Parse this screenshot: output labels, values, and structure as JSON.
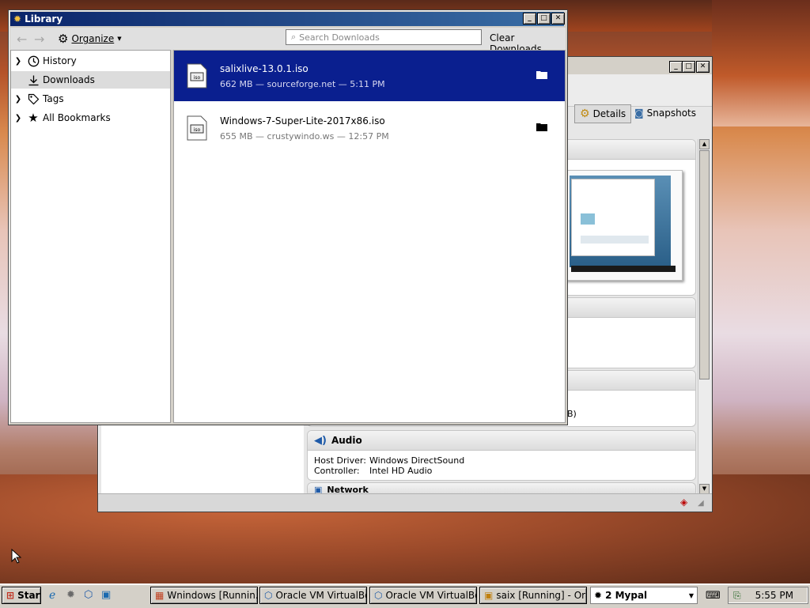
{
  "library": {
    "title": "Library",
    "organize_label": "Organize",
    "search_placeholder": "Search Downloads",
    "clear_label": "Clear Downloads",
    "sidebar": [
      {
        "label": "History",
        "icon": "clock-icon",
        "expandable": true,
        "selected": false
      },
      {
        "label": "Downloads",
        "icon": "download-icon",
        "expandable": false,
        "selected": true
      },
      {
        "label": "Tags",
        "icon": "tag-icon",
        "expandable": true,
        "selected": false
      },
      {
        "label": "All Bookmarks",
        "icon": "star-icon",
        "expandable": true,
        "selected": false
      }
    ],
    "downloads": [
      {
        "name": "salixlive-13.0.1.iso",
        "meta": "662 MB — sourceforge.net — 5:11 PM",
        "selected": true
      },
      {
        "name": "Windows-7-Super-Lite-2017x86.iso",
        "meta": "655 MB — crustywindo.ws — 12:57 PM",
        "selected": false
      }
    ]
  },
  "vbox": {
    "details_label": "Details",
    "snapshots_label": "Snapshots",
    "clipped_text": "B)",
    "audio": {
      "header": "Audio",
      "rows": [
        {
          "key": "Host Driver:",
          "value": "Windows DirectSound"
        },
        {
          "key": "Controller:",
          "value": "Intel HD Audio"
        }
      ]
    },
    "network_header": "Network"
  },
  "taskbar": {
    "start_label": "Start",
    "tasks": [
      {
        "label": "Wnindows  [Runnin..."
      },
      {
        "label": "Oracle VM VirtualBo..."
      },
      {
        "label": "Oracle VM VirtualBo..."
      },
      {
        "label": "saix [Running] - Ora..."
      }
    ],
    "lang_label": "2 Mypal",
    "clock": "5:55 PM"
  }
}
